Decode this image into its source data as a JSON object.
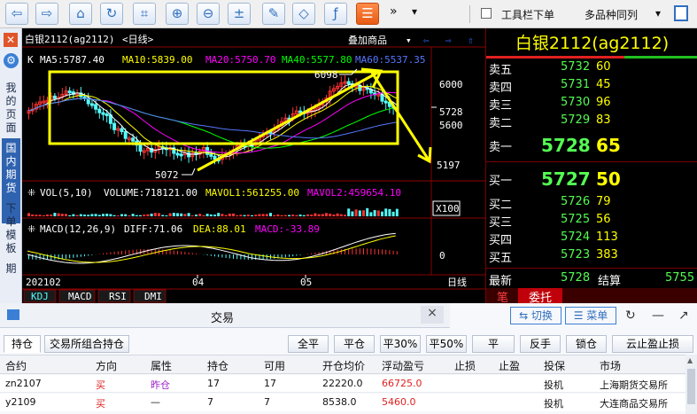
{
  "toolbar": {
    "toolbar_toggle_label": "工具栏下单",
    "multi_symbol_label": "多品种同列",
    "more_label": "»"
  },
  "sidebar": {
    "my_page": "我的页面",
    "domestic_futures": "国内期货",
    "order_template": "下单模板",
    "period": "期"
  },
  "chart": {
    "symbol_title": "白银2112(ag2112)",
    "period_label": "<日线>",
    "overlay_button": "叠加商品",
    "ma_line": {
      "k": "K",
      "ma5": "MA5:5787.40",
      "ma10": "MA10:5839.00",
      "ma20": "MA20:5750.70",
      "ma40": "MA40:5577.80",
      "ma60": "MA60:5537.35"
    },
    "price_labels": {
      "high": "6098",
      "low": "5072",
      "p6000": "6000",
      "p5728": "5728",
      "p5600": "5600",
      "p5197": "5197"
    },
    "vol_line": {
      "name": "VOL(5,10)",
      "volume": "VOLUME:718121.00",
      "mavol1": "MAVOL1:561255.00",
      "mavol2": "MAVOL2:459654.10"
    },
    "vol_scale": "X100",
    "macd_line": {
      "name": "MACD(12,26,9)",
      "diff": "DIFF:71.06",
      "dea": "DEA:88.01",
      "macd": "MACD:-33.89"
    },
    "macd_zero": "0",
    "x_labels": [
      "202102",
      "04",
      "05"
    ],
    "period_axis": "日线",
    "indicator_tabs": [
      "KDJ",
      "MACD",
      "RSI",
      "DMI"
    ],
    "colors": {
      "ma5": "#ffffff",
      "ma10": "#ffff00",
      "ma20": "#ff00ff",
      "ma40": "#00ff00",
      "ma60": "#5577ff",
      "up": "#ff3232",
      "down": "#54fcfc",
      "annotation": "#ffff00"
    }
  },
  "quote": {
    "title": "白银2112(ag2112)",
    "asks": [
      {
        "label": "卖五",
        "price": "5732",
        "volume": "60"
      },
      {
        "label": "卖四",
        "price": "5731",
        "volume": "45"
      },
      {
        "label": "卖三",
        "price": "5730",
        "volume": "96"
      },
      {
        "label": "卖二",
        "price": "5729",
        "volume": "83"
      }
    ],
    "ask1": {
      "label": "卖一",
      "price": "5728",
      "volume": "65"
    },
    "bid1": {
      "label": "买一",
      "price": "5727",
      "volume": "50"
    },
    "bids": [
      {
        "label": "买二",
        "price": "5726",
        "volume": "79"
      },
      {
        "label": "买三",
        "price": "5725",
        "volume": "56"
      },
      {
        "label": "买四",
        "price": "5724",
        "volume": "113"
      },
      {
        "label": "买五",
        "price": "5723",
        "volume": "383"
      }
    ],
    "latest_label": "最新",
    "latest_value": "5728",
    "settle_label": "结算",
    "settle_value": "5755",
    "tab_trades": "笔",
    "tab_orders": "委托"
  },
  "trade": {
    "title": "交易",
    "close_label": "×",
    "switch_button": "⇆ 切换",
    "menu_button": "☰ 菜单",
    "tabs": [
      "持仓",
      "交易所组合持仓"
    ],
    "actions": [
      "全平",
      "平仓",
      "平30%",
      "平50%",
      "平100%",
      "反手",
      "锁仓",
      "云止盈止损"
    ],
    "columns": [
      "合约",
      "方向",
      "属性",
      "持仓",
      "可用",
      "开仓均价",
      "浮动盈亏",
      "止损",
      "止盈",
      "投保",
      "市场"
    ],
    "rows": [
      {
        "contract": "zn2107",
        "direction": "买",
        "attr": "昨仓",
        "position": "17",
        "available": "17",
        "avg_price": "22220.0",
        "float_pnl": "66725.0",
        "stop_loss": "",
        "take_profit": "",
        "hedge": "投机",
        "market": "上海期货交易所"
      },
      {
        "contract": "y2109",
        "direction": "买",
        "attr": "—",
        "position": "7",
        "available": "7",
        "avg_price": "8538.0",
        "float_pnl": "5460.0",
        "stop_loss": "",
        "take_profit": "",
        "hedge": "投机",
        "market": "大连商品交易所"
      }
    ]
  }
}
